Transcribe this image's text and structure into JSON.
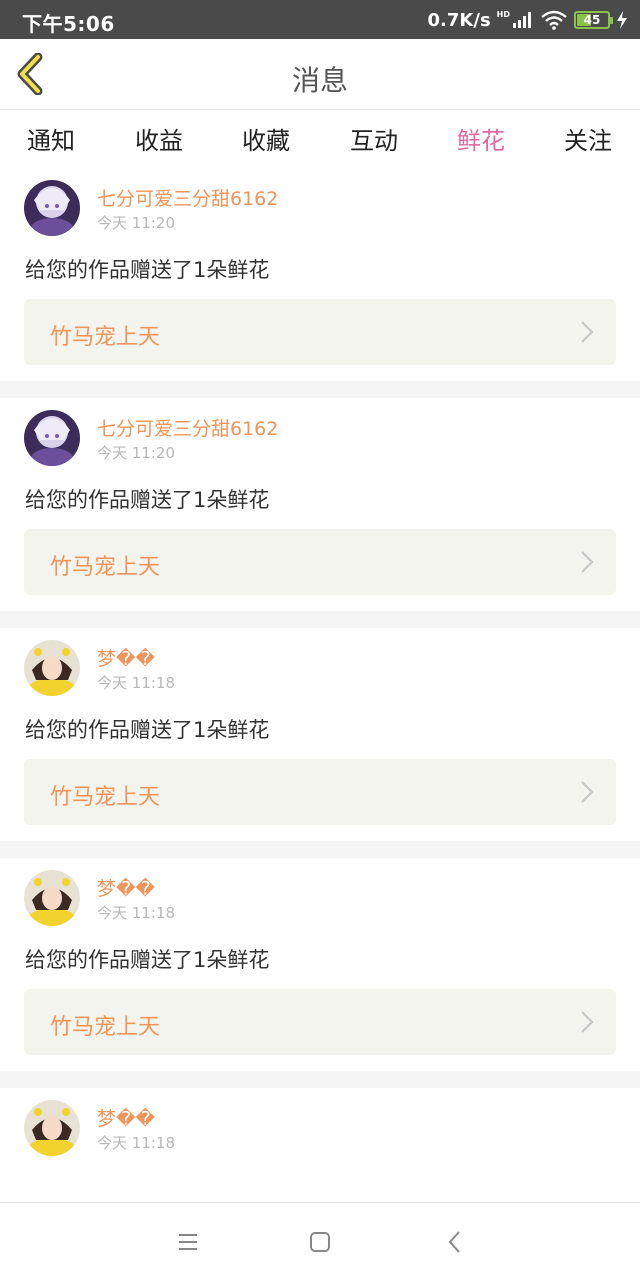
{
  "status_bar": {
    "time": "下午5:06",
    "network_speed": "0.7K/s",
    "hd": "HD",
    "battery": "45",
    "icons": [
      "signal-icon",
      "wifi-icon",
      "battery-icon",
      "charging-icon"
    ]
  },
  "header": {
    "title": "消息",
    "back_icon": "back-chevron-icon"
  },
  "tabs": [
    {
      "label": "通知",
      "active": false
    },
    {
      "label": "收益",
      "active": false
    },
    {
      "label": "收藏",
      "active": false
    },
    {
      "label": "互动",
      "active": false
    },
    {
      "label": "鲜花",
      "active": true
    },
    {
      "label": "关注",
      "active": false
    }
  ],
  "notifications": [
    {
      "user": "七分可爱三分甜6162",
      "time": "今天  11:20",
      "message": "给您的作品赠送了1朵鲜花",
      "work": "竹马宠上天",
      "avatar": "avatar-purple"
    },
    {
      "user": "七分可爱三分甜6162",
      "time": "今天  11:20",
      "message": "给您的作品赠送了1朵鲜花",
      "work": "竹马宠上天",
      "avatar": "avatar-purple"
    },
    {
      "user": "梦��",
      "time": "今天  11:18",
      "message": "给您的作品赠送了1朵鲜花",
      "work": "竹马宠上天",
      "avatar": "avatar-yellow"
    },
    {
      "user": "梦��",
      "time": "今天  11:18",
      "message": "给您的作品赠送了1朵鲜花",
      "work": "竹马宠上天",
      "avatar": "avatar-yellow"
    },
    {
      "user": "梦��",
      "time": "今天  11:18",
      "message": "",
      "work": "",
      "avatar": "avatar-yellow"
    }
  ],
  "colors": {
    "accent": "#e06aa0",
    "username": "#f0955a",
    "status_bar": "#4a4a4a",
    "work_box": "#f4f4ef"
  },
  "system_nav": [
    "menu-icon",
    "home-icon",
    "back-icon"
  ]
}
